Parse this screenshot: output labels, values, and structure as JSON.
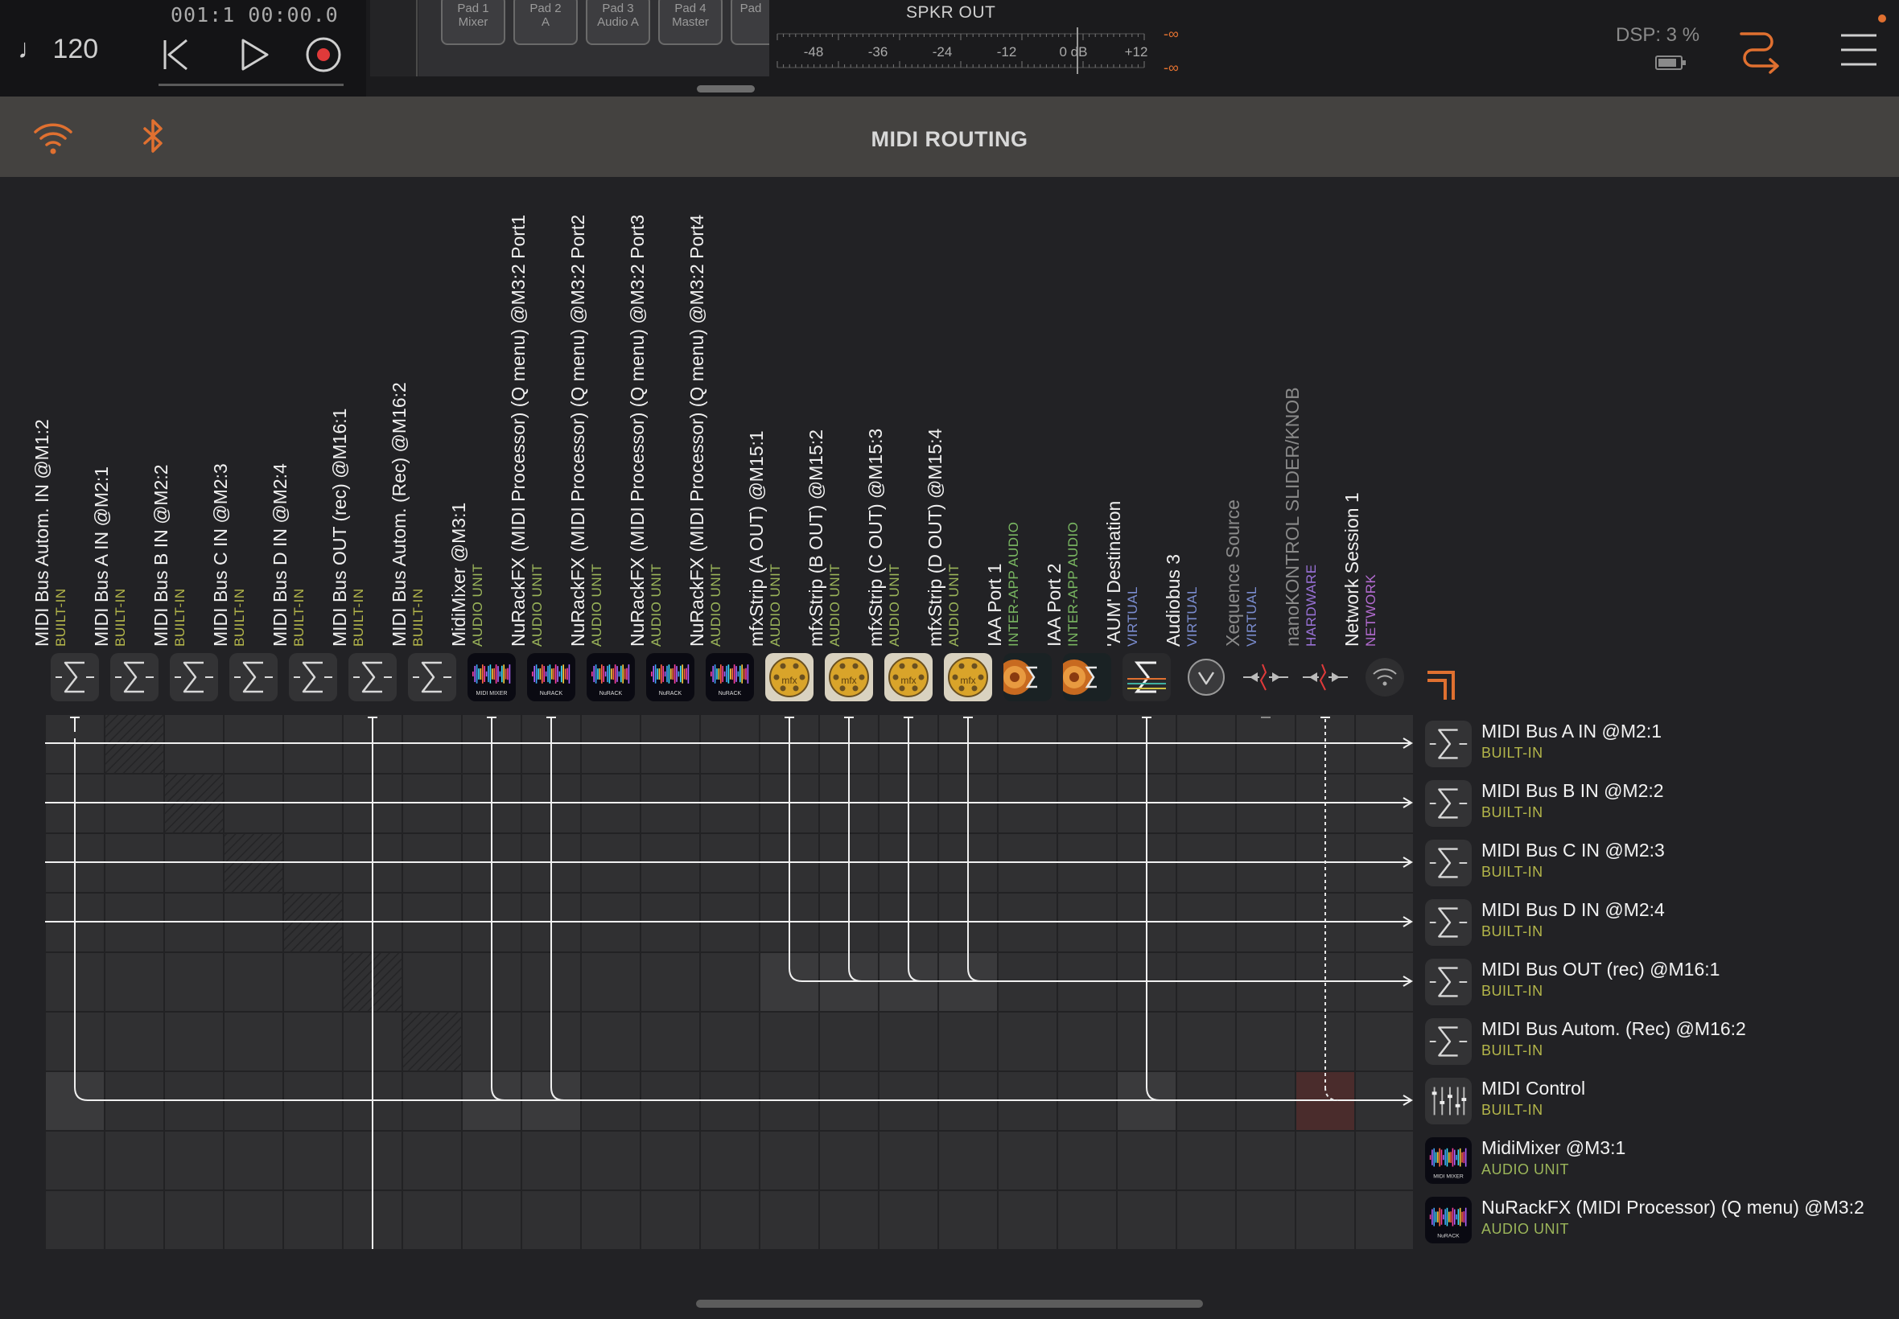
{
  "transport": {
    "tempo": "♩ 120",
    "position": "001:1   00:00.0"
  },
  "pads": [
    {
      "label": "Pad 1\nMixer"
    },
    {
      "label": "Pad 2\nA"
    },
    {
      "label": "Pad 3\nAudio A"
    },
    {
      "label": "Pad 4\nMaster"
    },
    {
      "label": "Pad"
    }
  ],
  "meter": {
    "title": "SPKR OUT",
    "scale": [
      "-48",
      "-36",
      "-24",
      "-12",
      "0 dB",
      "+12"
    ],
    "left_value": "-∞",
    "right_value": "-∞"
  },
  "dsp": {
    "label": "DSP:  3 %"
  },
  "header": {
    "title": "MIDI ROUTING"
  },
  "colors": {
    "accent": "#e07030",
    "builtin": "#b4b64a",
    "audio_unit": "#9cb65a",
    "inter_app": "#7ab862",
    "virtual": "#7b8dd0",
    "hardware": "#9a72d8",
    "network": "#b46cd2"
  },
  "sources": [
    {
      "name": "MIDI Bus Autom. IN @M1:2",
      "type": "BUILT-IN",
      "icon": "sigma-icon"
    },
    {
      "name": "MIDI Bus A IN @M2:1",
      "type": "BUILT-IN",
      "icon": "sigma-icon"
    },
    {
      "name": "MIDI Bus B IN @M2:2",
      "type": "BUILT-IN",
      "icon": "sigma-icon"
    },
    {
      "name": "MIDI Bus C IN @M2:3",
      "type": "BUILT-IN",
      "icon": "sigma-icon"
    },
    {
      "name": "MIDI Bus D IN @M2:4",
      "type": "BUILT-IN",
      "icon": "sigma-icon"
    },
    {
      "name": "MIDI Bus OUT (rec) @M16:1",
      "type": "BUILT-IN",
      "icon": "sigma-icon"
    },
    {
      "name": "MIDI Bus Autom. (Rec) @M16:2",
      "type": "BUILT-IN",
      "icon": "sigma-icon"
    },
    {
      "name": "MidiMixer @M3:1",
      "type": "AUDIO UNIT",
      "icon": "midimixer-icon"
    },
    {
      "name": "NuRackFX (MIDI Processor) (Q menu) @M3:2 Port1",
      "type": "AUDIO UNIT",
      "icon": "nurack-icon"
    },
    {
      "name": "NuRackFX (MIDI Processor) (Q menu) @M3:2 Port2",
      "type": "AUDIO UNIT",
      "icon": "nurack-icon"
    },
    {
      "name": "NuRackFX (MIDI Processor) (Q menu) @M3:2 Port3",
      "type": "AUDIO UNIT",
      "icon": "nurack-icon"
    },
    {
      "name": "NuRackFX (MIDI Processor) (Q menu) @M3:2 Port4",
      "type": "AUDIO UNIT",
      "icon": "nurack-icon"
    },
    {
      "name": "mfxStrip (A OUT) @M15:1",
      "type": "AUDIO UNIT",
      "icon": "mfx-icon"
    },
    {
      "name": "mfxStrip (B OUT) @M15:2",
      "type": "AUDIO UNIT",
      "icon": "mfx-icon"
    },
    {
      "name": "mfxStrip (C OUT) @M15:3",
      "type": "AUDIO UNIT",
      "icon": "mfx-icon"
    },
    {
      "name": "mfxStrip (D OUT) @M15:4",
      "type": "AUDIO UNIT",
      "icon": "mfx-icon"
    },
    {
      "name": "IAA Port 1",
      "type": "INTER-APP AUDIO",
      "icon": "iaa-icon"
    },
    {
      "name": "IAA Port 2",
      "type": "INTER-APP AUDIO",
      "icon": "iaa-icon"
    },
    {
      "name": "'AUM' Destination",
      "type": "VIRTUAL",
      "icon": "aum-destination-icon"
    },
    {
      "name": "Audiobus 3",
      "type": "VIRTUAL",
      "icon": "audiobus-icon"
    },
    {
      "name": "Xequence Source",
      "type": "VIRTUAL",
      "icon": "xequence-icon"
    },
    {
      "name": "nanoKONTROL SLIDER/KNOB",
      "type": "HARDWARE",
      "icon": "hardware-icon"
    },
    {
      "name": "Network Session 1",
      "type": "NETWORK",
      "icon": "network-icon"
    }
  ],
  "destinations": [
    {
      "name": "MIDI Bus A IN @M2:1",
      "type": "BUILT-IN",
      "icon": "sigma-icon"
    },
    {
      "name": "MIDI Bus B IN @M2:2",
      "type": "BUILT-IN",
      "icon": "sigma-icon"
    },
    {
      "name": "MIDI Bus C IN @M2:3",
      "type": "BUILT-IN",
      "icon": "sigma-icon"
    },
    {
      "name": "MIDI Bus D IN @M2:4",
      "type": "BUILT-IN",
      "icon": "sigma-icon"
    },
    {
      "name": "MIDI Bus OUT (rec) @M16:1",
      "type": "BUILT-IN",
      "icon": "sigma-icon"
    },
    {
      "name": "MIDI Bus Autom. (Rec) @M16:2",
      "type": "BUILT-IN",
      "icon": "sigma-icon"
    },
    {
      "name": "MIDI Control",
      "type": "BUILT-IN",
      "icon": "faders-icon"
    },
    {
      "name": "MidiMixer @M3:1",
      "type": "AUDIO UNIT",
      "icon": "midimixer-icon"
    },
    {
      "name": "NuRackFX (MIDI Processor) (Q menu) @M3:2",
      "type": "AUDIO UNIT",
      "icon": "nurack-icon"
    }
  ]
}
